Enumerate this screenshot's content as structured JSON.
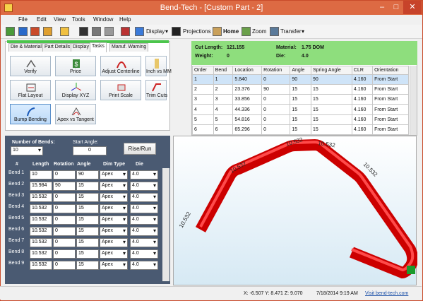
{
  "window": {
    "title": "Bend-Tech - [Custom Part - 2]"
  },
  "menu": [
    "File",
    "Edit",
    "View",
    "Tools",
    "Window",
    "Help"
  ],
  "toolbar": {
    "display": "Display",
    "projections": "Projections",
    "home": "Home",
    "zoom": "Zoom",
    "transfer": "Transfer"
  },
  "tabs": [
    "Die & Material",
    "Part Details",
    "Display",
    "Tasks",
    "Manuf. Warning"
  ],
  "active_tab": "Tasks",
  "tools": [
    {
      "label": "Verify",
      "icon": "verify-icon"
    },
    {
      "label": "Price",
      "icon": "price-icon"
    },
    {
      "label": "Adjust Centerline",
      "icon": "centerline-icon"
    },
    {
      "label": "Inch vs MM",
      "icon": "ruler-icon"
    },
    {
      "label": "Flat Layout",
      "icon": "flat-layout-icon"
    },
    {
      "label": "Display XYZ",
      "icon": "xyz-axes-icon"
    },
    {
      "label": "Print Scale",
      "icon": "print-scale-icon"
    },
    {
      "label": "Trim Cuts",
      "icon": "trim-cuts-icon"
    },
    {
      "label": "Bump Bending",
      "icon": "bump-bending-icon"
    },
    {
      "label": "Apex vs Tangent",
      "icon": "apex-tangent-icon"
    }
  ],
  "info": {
    "cut_length_label": "Cut Length:",
    "cut_length": "121.155",
    "material_label": "Material:",
    "material": "1.75 DOM",
    "weight_label": "Weight:",
    "weight": "0",
    "die_label": "Die:",
    "die": "4.0"
  },
  "bend_table": {
    "headers": [
      "Order",
      "Bend",
      "Location",
      "Rotation",
      "Angle",
      "Spring Angle",
      "CLR",
      "Orientation"
    ],
    "rows": [
      [
        "1",
        "1",
        "5.840",
        "0",
        "90",
        "90",
        "4.160",
        "From Start"
      ],
      [
        "2",
        "2",
        "23.376",
        "90",
        "15",
        "15",
        "4.160",
        "From Start"
      ],
      [
        "3",
        "3",
        "33.856",
        "0",
        "15",
        "15",
        "4.160",
        "From Start"
      ],
      [
        "4",
        "4",
        "44.336",
        "0",
        "15",
        "15",
        "4.160",
        "From Start"
      ],
      [
        "5",
        "5",
        "54.816",
        "0",
        "15",
        "15",
        "4.160",
        "From Start"
      ],
      [
        "6",
        "6",
        "65.296",
        "0",
        "15",
        "15",
        "4.160",
        "From Start"
      ]
    ]
  },
  "bends_form": {
    "number_label": "Number of Bends:",
    "number_value": "10",
    "start_angle_label": "Start Angle:",
    "start_angle_value": "0",
    "rerun_label": "Rise/Run",
    "headers": [
      "#",
      "Length",
      "Rotation",
      "Angle",
      "Dim Type",
      "Die"
    ],
    "rows": [
      [
        "Bend 1",
        "10",
        "0",
        "90",
        "Apex",
        "4.0"
      ],
      [
        "Bend 2",
        "15.984",
        "90",
        "15",
        "Apex",
        "4.0"
      ],
      [
        "Bend 3",
        "10.532",
        "0",
        "15",
        "Apex",
        "4.0"
      ],
      [
        "Bend 4",
        "10.532",
        "0",
        "15",
        "Apex",
        "4.0"
      ],
      [
        "Bend 5",
        "10.532",
        "0",
        "15",
        "Apex",
        "4.0"
      ],
      [
        "Bend 6",
        "10.532",
        "0",
        "15",
        "Apex",
        "4.0"
      ],
      [
        "Bend 7",
        "10.532",
        "0",
        "15",
        "Apex",
        "4.0"
      ],
      [
        "Bend 8",
        "10.532",
        "0",
        "15",
        "Apex",
        "4.0"
      ],
      [
        "Bend 9",
        "10.532",
        "0",
        "15",
        "Apex",
        "4.0"
      ]
    ]
  },
  "viewport": {
    "dims": [
      "10.532",
      "10.532",
      "10.532",
      "10.532",
      "10.532"
    ],
    "tube_color": "#d01010"
  },
  "status": {
    "coords": "X: -6.507  Y: 8.471  Z: 9.070",
    "datetime": "7/18/2014  9:19 AM",
    "link": "Visit bend-tech.com"
  }
}
